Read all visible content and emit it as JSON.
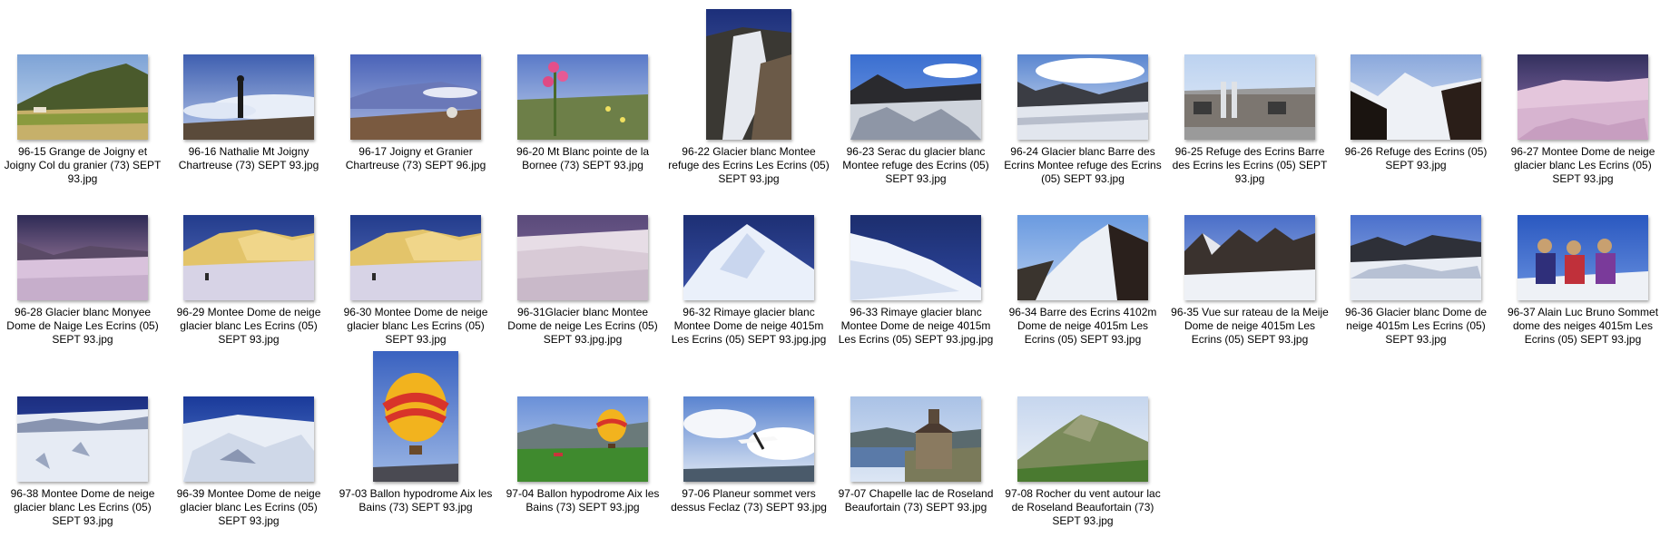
{
  "items": [
    {
      "name": "96-15 Grange de  Joigny et Joigny Col du granier (73) SEPT 93.jpg",
      "scene": "meadow"
    },
    {
      "name": "96-16 Nathalie Mt Joigny Chartreuse (73) SEPT 93.jpg",
      "scene": "person-clouds"
    },
    {
      "name": "96-17 Joigny et Granier Chartreuse (73) SEPT 96.jpg",
      "scene": "mountain-haze"
    },
    {
      "name": "96-20 Mt Blanc pointe de la Bornee (73) SEPT 93.jpg",
      "scene": "flowers"
    },
    {
      "name": "96-22 Glacier blanc Montee refuge des Ecrins Les Ecrins (05) SEPT 93.jpg",
      "scene": "glacier-portrait"
    },
    {
      "name": "96-23 Serac du glacier blanc Montee refuge des Ecrins (05) SEPT 93.jpg",
      "scene": "serac"
    },
    {
      "name": "96-24 Glacier blanc Barre des Ecrins Montee refuge des Ecrins (05) SEPT 93.jpg",
      "scene": "glacier-wide"
    },
    {
      "name": "96-25 Refuge des Ecrins Barre des Ecrins les Ecrins (05) SEPT 93.jpg",
      "scene": "refuge"
    },
    {
      "name": "96-26 Refuge des Ecrins (05) SEPT 93.jpg",
      "scene": "dark-peak"
    },
    {
      "name": "96-27 Montee Dome de neige glacier blanc Les Ecrins (05) SEPT 93.jpg",
      "scene": "pink-snow"
    },
    {
      "name": "96-28 Glacier blanc Monyee Dome de Naige Les Ecrins (05) SEPT 93.jpg",
      "scene": "pink-snow-2"
    },
    {
      "name": "96-29 Montee Dome de neige glacier blanc Les Ecrins (05) SEPT 93.jpg",
      "scene": "golden-snow"
    },
    {
      "name": "96-30 Montee Dome de neige glacier blanc Les Ecrins (05) SEPT 93.jpg",
      "scene": "golden-snow"
    },
    {
      "name": "96-31Glacier blanc Montee Dome de neige Les Ecrins (05) SEPT 93.jpg.jpg",
      "scene": "snow-field"
    },
    {
      "name": "96-32 Rimaye glacier blanc Montee Dome de neige 4015m Les Ecrins (05) SEPT 93.jpg.jpg",
      "scene": "ice-slope"
    },
    {
      "name": "96-33 Rimaye glacier blanc Montee Dome de neige 4015m Les Ecrins (05) SEPT 93.jpg.jpg",
      "scene": "ice-slope-2"
    },
    {
      "name": "96-34 Barre des Ecrins 4102m Dome de neige 4015m Les Ecrins (05) SEPT 93.jpg",
      "scene": "ridge"
    },
    {
      "name": "96-35 Vue sur rateau de la Meije Dome de neige 4015m Les Ecrins (05) SEPT 93.jpg",
      "scene": "range"
    },
    {
      "name": "96-36 Glacier blanc Dome de neige 4015m Les Ecrins (05) SEPT 93.jpg",
      "scene": "range-2"
    },
    {
      "name": "96-37 Alain Luc Bruno Sommet dome des neiges 4015m Les Ecrins (05) SEPT 93.jpg",
      "scene": "climbers"
    },
    {
      "name": "96-38 Montee Dome de neige glacier blanc Les Ecrins (05) SEPT 93.jpg",
      "scene": "crevasses"
    },
    {
      "name": "96-39 Montee Dome de neige glacier blanc Les Ecrins (05) SEPT 93.jpg",
      "scene": "crevasses-2"
    },
    {
      "name": "97-03 Ballon hypodrome Aix les Bains (73) SEPT 93.jpg",
      "scene": "balloon-portrait"
    },
    {
      "name": "97-04 Ballon hypodrome Aix les Bains (73) SEPT 93.jpg",
      "scene": "balloon-field"
    },
    {
      "name": "97-06 Planeur sommet vers dessus Feclaz (73) SEPT 93.jpg",
      "scene": "glider"
    },
    {
      "name": "97-07 Chapelle lac de Roseland Beaufortain (73) SEPT 93.jpg",
      "scene": "chapel"
    },
    {
      "name": "97-08 Rocher du vent autour lac de Roseland Beaufortain (73) SEPT 93.jpg",
      "scene": "green-peak"
    }
  ]
}
